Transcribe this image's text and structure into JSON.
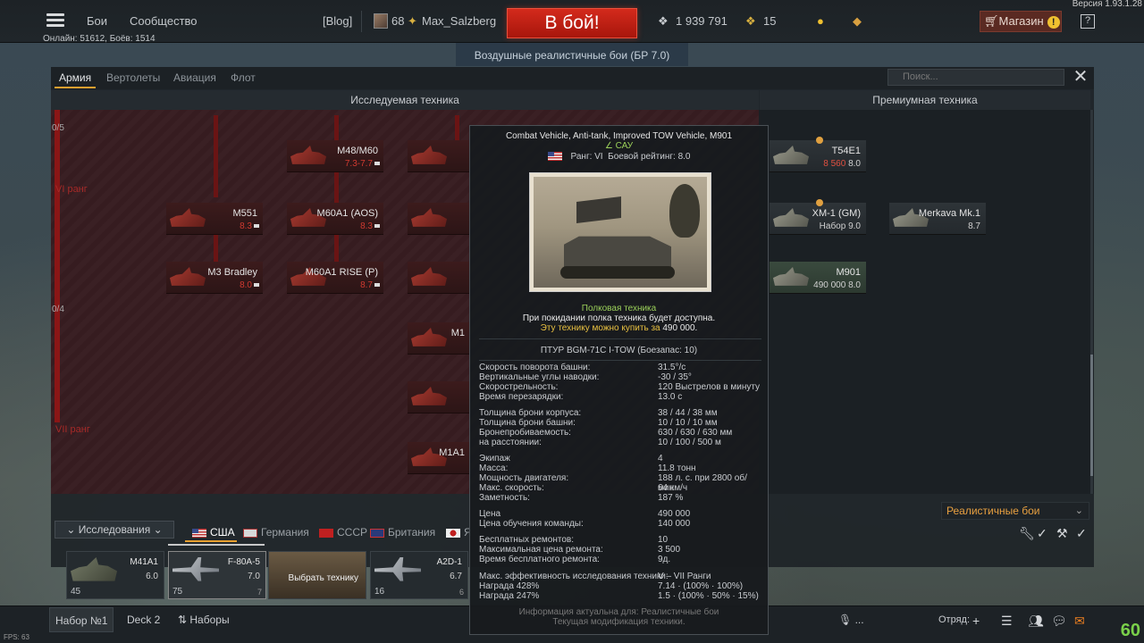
{
  "header": {
    "menu_label": "Бои",
    "community_label": "Сообщество",
    "online": "Онлайн: 51612, Боёв: 1514",
    "blog": "[Blog]",
    "player_level": "68",
    "player_name": "Max_Salzberg",
    "battle_btn": "В бой!",
    "silver_lions": "1 939 791",
    "golden_eagles": "15",
    "shop_label": "Магазин",
    "help_label": "?",
    "version": "Версия 1.93.1.28",
    "game_mode": "Воздушные реалистичные бои (БР 7.0)"
  },
  "window": {
    "tabs": [
      "Армия",
      "Вертолеты",
      "Авиация",
      "Флот"
    ],
    "search_placeholder": "Поиск...",
    "col_research": "Исследуемая техника",
    "col_premium": "Премиумная техника",
    "rank6_label": "VI ранг",
    "rank7_label": "VII ранг",
    "count_a": "0/5",
    "count_b": "0/4",
    "mode_select": "Реалистичные бои"
  },
  "tree": {
    "m48m60": {
      "name": "M48/M60",
      "br": "7.3-7.7"
    },
    "m551": {
      "name": "M551",
      "br": "8.3"
    },
    "m60a1aos": {
      "name": "M60A1 (AOS)",
      "br": "8.3"
    },
    "m3bradley": {
      "name": "M3 Bradley",
      "br": "8.0"
    },
    "m60a1rise": {
      "name": "M60A1 RISE (P)",
      "br": "8.7"
    },
    "m1": {
      "name": "M1"
    },
    "m1a1": {
      "name": "M1A1"
    }
  },
  "premium": {
    "t54e1": {
      "name": "T54E1",
      "price": "8 560",
      "br": "8.0"
    },
    "xm1gm": {
      "name": "XM-1 (GM)",
      "pack": "Набор 9.0"
    },
    "merkava": {
      "name": "Merkava Mk.1",
      "br": "8.7"
    },
    "m901": {
      "name": "M901",
      "price": "490 000",
      "br": "8.0"
    }
  },
  "tooltip": {
    "title": "Combat Vehicle, Anti-tank, Improved TOW Vehicle, M901",
    "type": "САУ",
    "rank": "Ранг: VI",
    "br": "Боевой рейтинг: 8.0",
    "regimental": "Полковая техника",
    "regimental_note": "При покидании полка техника будет доступна.",
    "buy_note": "Эту технику можно купить за",
    "buy_price": "490 000",
    "weapon": "ПТУР BGM-71C I-TOW (Боезапас: 10)",
    "stats": [
      {
        "k": "Скорость поворота башни:",
        "v": "31.5°/с"
      },
      {
        "k": "Вертикальные углы наводки:",
        "v": "-30 / 35°"
      },
      {
        "k": "Скорострельность:",
        "v": "120 Выстрелов в минуту"
      },
      {
        "k": "Время перезарядки:",
        "v": "13.0 с"
      }
    ],
    "armor": [
      {
        "k": "Толщина брони корпуса:",
        "v": "38 / 44 / 38 мм"
      },
      {
        "k": "Толщина брони башни:",
        "v": "10 / 10 / 10 мм"
      },
      {
        "k": "Бронепробиваемость:",
        "v": "630 / 630 / 630 мм"
      },
      {
        "k": "на расстоянии:",
        "v": "10 / 100 / 500 м"
      }
    ],
    "mobility": [
      {
        "k": "Экипаж",
        "v": "4"
      },
      {
        "k": "Масса:",
        "v": "11.8 тонн"
      },
      {
        "k": "Мощность двигателя:",
        "v": "188 л. с. при 2800 об/мин"
      },
      {
        "k": "Макс. скорость:",
        "v": "64 км/ч"
      },
      {
        "k": "Заметность:",
        "v": "187 %"
      }
    ],
    "cost": [
      {
        "k": "Цена",
        "v": "490 000"
      },
      {
        "k": "Цена обучения команды:",
        "v": "140 000"
      }
    ],
    "repair": [
      {
        "k": "Бесплатных ремонтов:",
        "v": "10"
      },
      {
        "k": "Максимальная цена ремонта:",
        "v": "3 500"
      },
      {
        "k": "Время бесплатного ремонта:",
        "v": "9д."
      }
    ],
    "research_eff_k": "Макс. эффективность исследования техники:",
    "research_eff_v": "V – VII Ранги",
    "reward1_k": "Награда 428%",
    "reward1_v": "7.14 · (100% · 100%)",
    "reward2_k": "Награда 247%",
    "reward2_v": "1.5 · (100% · 50% · 15%)",
    "footer1": "Информация актуальна для: Реалистичные бои",
    "footer2": "Текущая модификация техники."
  },
  "bottom": {
    "research_tab": "Исследования",
    "nations": [
      "США",
      "Германия",
      "СССР",
      "Британия",
      "Я"
    ],
    "slots": [
      {
        "name": "M41A1",
        "br": "6.0",
        "count": "45"
      },
      {
        "name": "F-80A-5",
        "br": "7.0",
        "count": "75",
        "crew": "7"
      },
      {
        "name": "Выбрать технику"
      },
      {
        "name": "A2D-1",
        "br": "6.7",
        "count": "16",
        "crew": "6"
      }
    ],
    "preset1": "Набор №1",
    "preset2": "Deck 2",
    "presets": "Наборы",
    "mic": "...",
    "squad": "Отряд:",
    "fps_small": "FPS: 63",
    "fps_big": "60"
  }
}
